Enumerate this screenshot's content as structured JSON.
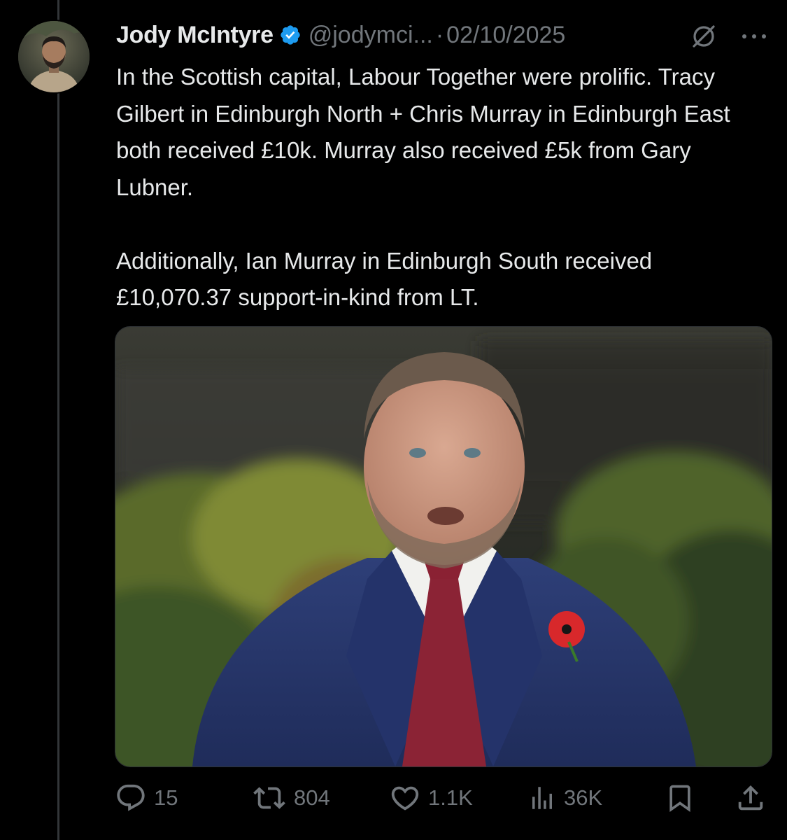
{
  "tweet": {
    "author": {
      "name": "Jody McIntyre",
      "handle": "@jodymci...",
      "verified": true,
      "badge_color": "#1d9bf0"
    },
    "separator": "·",
    "date": "02/10/2025",
    "header_icons": [
      "edited-icon",
      "more-icon"
    ],
    "paragraphs": [
      "In the Scottish capital, Labour Together were prolific. Tracy Gilbert in Edinburgh North + Chris Murray in Edinburgh East both received £10k. Murray also received £5k from Gary Lubner.",
      "Additionally, Ian Murray in Edinburgh South received £10,070.37 support-in-kind from LT."
    ],
    "actions": {
      "reply": {
        "icon": "reply-icon",
        "count": "15"
      },
      "repost": {
        "icon": "repost-icon",
        "count": "804"
      },
      "like": {
        "icon": "like-icon",
        "count": "1.1K"
      },
      "views": {
        "icon": "views-icon",
        "count": "36K"
      },
      "bookmark": {
        "icon": "bookmark-icon"
      },
      "share": {
        "icon": "share-icon"
      }
    }
  },
  "colors": {
    "background": "#000000",
    "text_primary": "#e7e9ea",
    "text_secondary": "#71767b",
    "thread_line": "#333639",
    "accent": "#1d9bf0"
  }
}
